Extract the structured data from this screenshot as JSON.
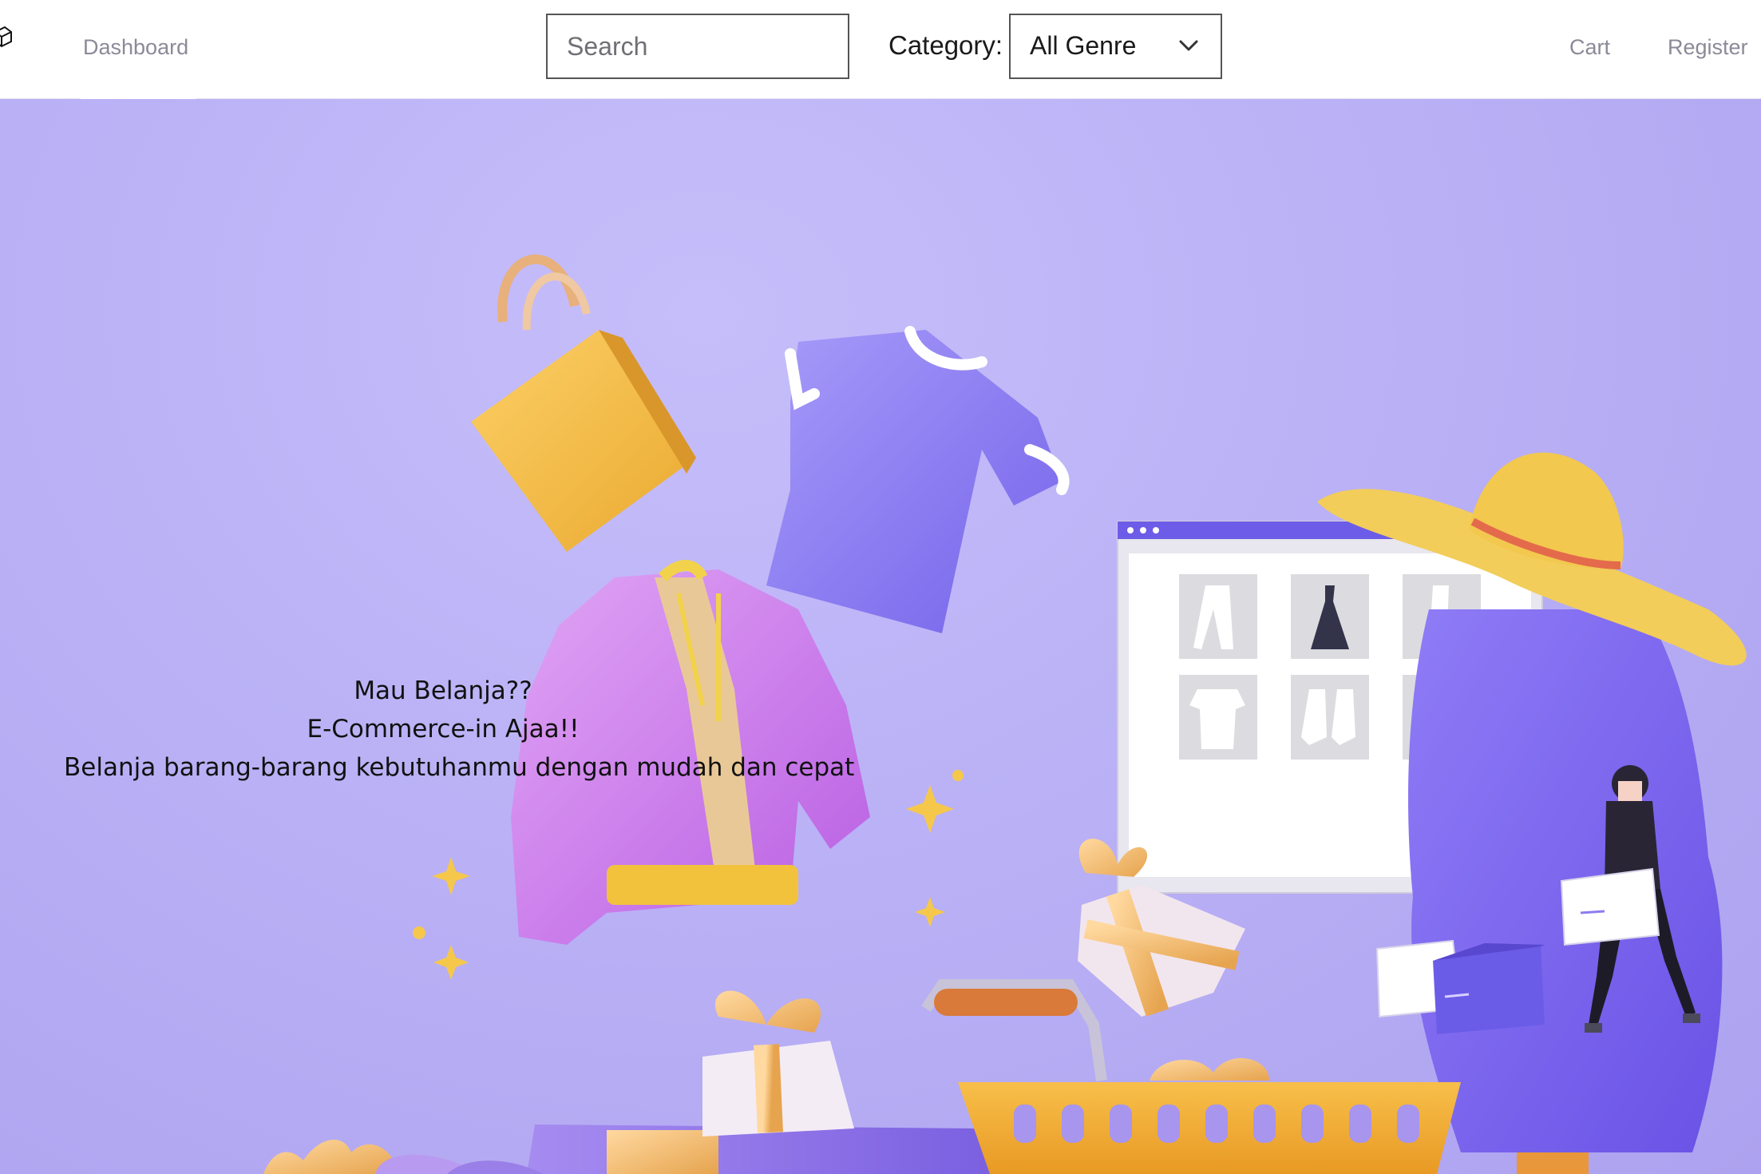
{
  "nav": {
    "dashboard": "Dashboard",
    "cart": "Cart",
    "register": "Register"
  },
  "search": {
    "placeholder": "Search",
    "value": ""
  },
  "category": {
    "label": "Category:",
    "selected": "All Genre"
  },
  "hero": {
    "line1": "Mau Belanja??",
    "line2": "E-Commerce-in Ajaa!!",
    "line3": "Belanja barang-barang kebutuhanmu dengan mudah dan cepat"
  },
  "colors": {
    "hero_bg": "#bab1f6",
    "nav_link": "#8b8a98",
    "accent_purple": "#7d6cf0",
    "accent_yellow": "#f2b63c"
  },
  "icons": [
    "logo-icon",
    "chevron-down-icon"
  ]
}
